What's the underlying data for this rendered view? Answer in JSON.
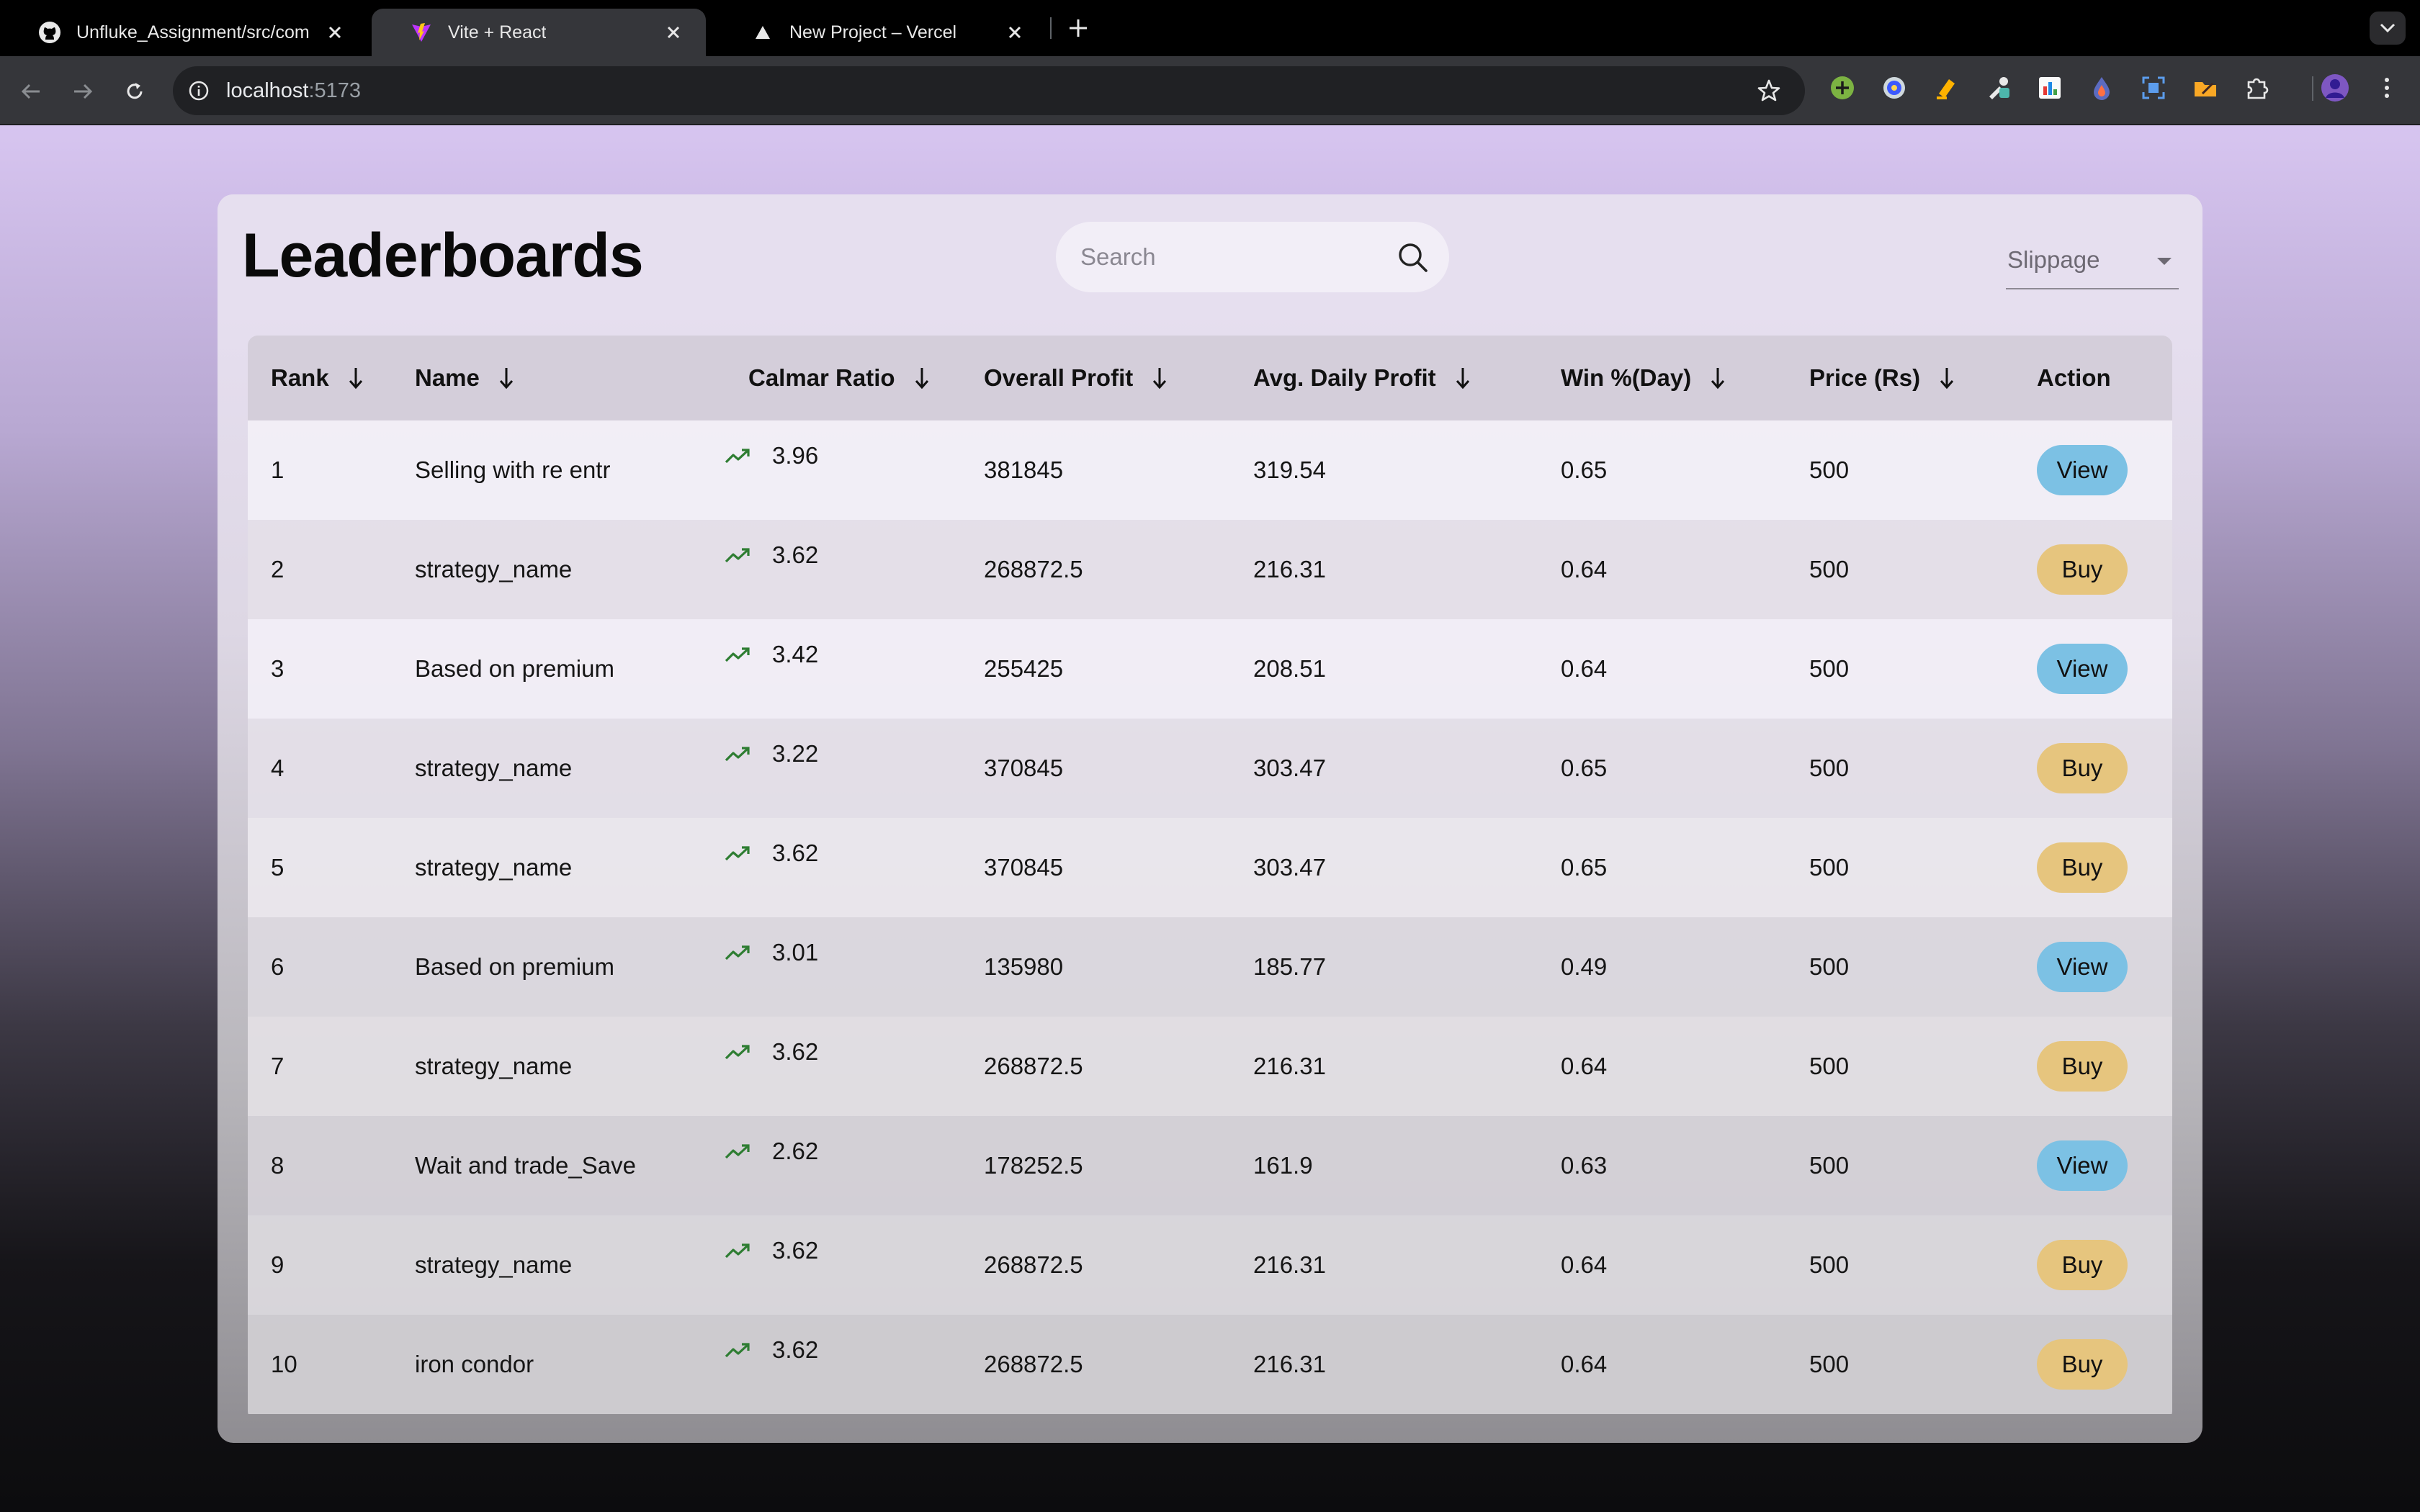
{
  "browser": {
    "tabs": [
      {
        "title": "Unfluke_Assignment/src/com",
        "icon": "github-icon"
      },
      {
        "title": "Vite + React",
        "icon": "vite-icon"
      },
      {
        "title": "New Project – Vercel",
        "icon": "vercel-icon"
      }
    ],
    "url_host": "localhost",
    "url_port": ":5173"
  },
  "page": {
    "title": "Leaderboards",
    "search_placeholder": "Search",
    "slippage_label": "Slippage"
  },
  "table": {
    "headers": {
      "rank": "Rank",
      "name": "Name",
      "calmar": "Calmar Ratio",
      "overall_profit": "Overall Profit",
      "avg_daily_profit": "Avg. Daily Profit",
      "win": "Win %(Day)",
      "price": "Price (Rs)",
      "action": "Action"
    },
    "rows": [
      {
        "rank": "1",
        "name": "Selling with re entr",
        "calmar": "3.96",
        "overall_profit": "381845",
        "avg_daily_profit": "319.54",
        "win": "0.65",
        "price": "500",
        "action": "View"
      },
      {
        "rank": "2",
        "name": "strategy_name",
        "calmar": "3.62",
        "overall_profit": "268872.5",
        "avg_daily_profit": "216.31",
        "win": "0.64",
        "price": "500",
        "action": "Buy"
      },
      {
        "rank": "3",
        "name": "Based on premium",
        "calmar": "3.42",
        "overall_profit": "255425",
        "avg_daily_profit": "208.51",
        "win": "0.64",
        "price": "500",
        "action": "View"
      },
      {
        "rank": "4",
        "name": "strategy_name",
        "calmar": "3.22",
        "overall_profit": "370845",
        "avg_daily_profit": "303.47",
        "win": "0.65",
        "price": "500",
        "action": "Buy"
      },
      {
        "rank": "5",
        "name": "strategy_name",
        "calmar": "3.62",
        "overall_profit": "370845",
        "avg_daily_profit": "303.47",
        "win": "0.65",
        "price": "500",
        "action": "Buy"
      },
      {
        "rank": "6",
        "name": "Based on premium",
        "calmar": "3.01",
        "overall_profit": "135980",
        "avg_daily_profit": "185.77",
        "win": "0.49",
        "price": "500",
        "action": "View"
      },
      {
        "rank": "7",
        "name": "strategy_name",
        "calmar": "3.62",
        "overall_profit": "268872.5",
        "avg_daily_profit": "216.31",
        "win": "0.64",
        "price": "500",
        "action": "Buy"
      },
      {
        "rank": "8",
        "name": "Wait and trade_Save",
        "calmar": "2.62",
        "overall_profit": "178252.5",
        "avg_daily_profit": "161.9",
        "win": "0.63",
        "price": "500",
        "action": "View"
      },
      {
        "rank": "9",
        "name": "strategy_name",
        "calmar": "3.62",
        "overall_profit": "268872.5",
        "avg_daily_profit": "216.31",
        "win": "0.64",
        "price": "500",
        "action": "Buy"
      },
      {
        "rank": "10",
        "name": "iron condor",
        "calmar": "3.62",
        "overall_profit": "268872.5",
        "avg_daily_profit": "216.31",
        "win": "0.64",
        "price": "500",
        "action": "Buy"
      }
    ]
  },
  "colors": {
    "view_button": "#7cc1e4",
    "buy_button": "#e6c57e",
    "trend_up": "#2e7d32"
  }
}
